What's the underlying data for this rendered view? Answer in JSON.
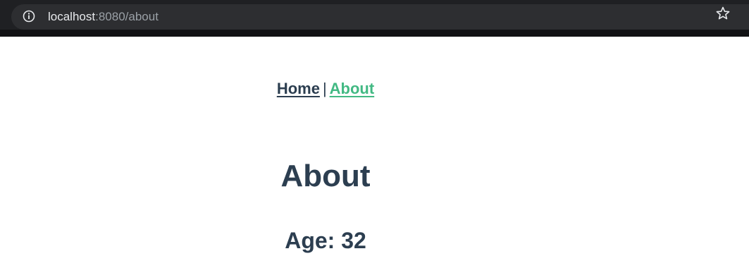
{
  "browser": {
    "url_host": "localhost",
    "url_path": ":8080/about",
    "info_icon": "info-icon",
    "bookmark_icon": "star-icon"
  },
  "nav": {
    "home_label": "Home",
    "separator": "|",
    "about_label": "About",
    "active_color": "#42b983",
    "text_color": "#2c3e50"
  },
  "page": {
    "title": "About",
    "age_label": "Age:",
    "age_value": "32"
  }
}
